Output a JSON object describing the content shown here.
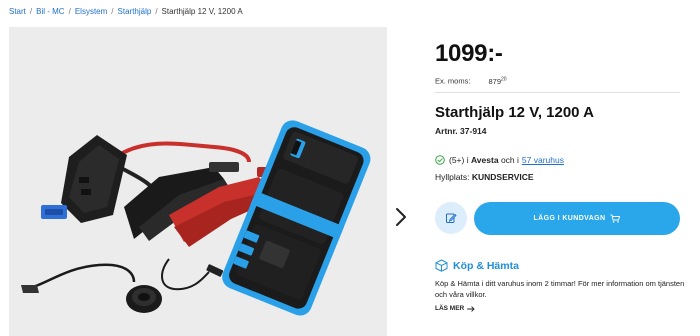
{
  "breadcrumb": {
    "items": [
      "Start",
      "Bil - MC",
      "Elsystem",
      "Starthjälp"
    ],
    "current": "Starthjälp 12 V, 1200 A",
    "separator": "/"
  },
  "product": {
    "price": "1099:-",
    "ex_moms_label": "Ex. moms:",
    "ex_moms_value": "879",
    "ex_moms_cents": "20",
    "title": "Starthjälp 12 V, 1200 A",
    "artnr": "Artnr. 37-914"
  },
  "stock": {
    "count_text": "(5+) i",
    "store": "Avesta",
    "and_text": "och i",
    "link": "57 varuhus"
  },
  "shelf": {
    "label": "Hyllplats:",
    "value": "KUNDSERVICE"
  },
  "actions": {
    "favorite_icon": "edit-list-icon",
    "cart_label": "LÄGG I KUNDVAGN",
    "cart_icon": "cart-icon"
  },
  "kop_hamta": {
    "title": "Köp & Hämta",
    "text": "Köp & Hämta i ditt varuhus inom 2 timmar! För mer information om tjänsten och våra villkor.",
    "more": "LÄS MER"
  },
  "colors": {
    "accent": "#2aa6ea",
    "link": "#1f6fc9",
    "image_bg": "#ececec"
  }
}
